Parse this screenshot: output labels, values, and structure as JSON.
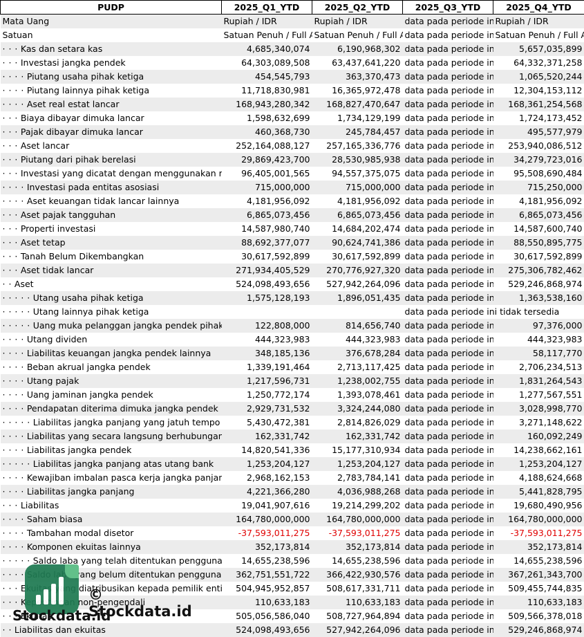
{
  "header": {
    "title": "PUDP",
    "periods": [
      "2025_Q1_YTD",
      "2025_Q2_YTD",
      "2025_Q3_YTD",
      "2025_Q4_YTD"
    ]
  },
  "rows": [
    {
      "label": "Mata Uang",
      "dots": "",
      "values": [
        "Rupiah / IDR",
        "Rupiah / IDR",
        "data pada periode ini",
        "Rupiah / IDR"
      ],
      "kind": "text"
    },
    {
      "label": "Satuan",
      "dots": "",
      "values": [
        "Satuan Penuh / Full Amount",
        "Satuan Penuh / Full Amount",
        "data pada periode ini",
        "Satuan Penuh / Full Amount"
      ],
      "kind": "text"
    },
    {
      "label": "Kas dan setara kas",
      "dots": "· · ·",
      "values": [
        "4,685,340,074",
        "6,190,968,302",
        "data pada periode in",
        "5,657,035,899"
      ]
    },
    {
      "label": "Investasi jangka pendek",
      "dots": "· · ·",
      "values": [
        "64,303,089,508",
        "63,437,641,220",
        "data pada periode in",
        "64,332,371,258"
      ]
    },
    {
      "label": "Piutang usaha pihak ketiga",
      "dots": "· · · ·",
      "values": [
        "454,545,793",
        "363,370,473",
        "data pada periode in",
        "1,065,520,244"
      ]
    },
    {
      "label": "Piutang lainnya pihak ketiga",
      "dots": "· · · ·",
      "values": [
        "11,718,830,981",
        "16,365,972,478",
        "data pada periode in",
        "12,304,153,112"
      ]
    },
    {
      "label": "Aset real estat lancar",
      "dots": "· · · ·",
      "values": [
        "168,943,280,342",
        "168,827,470,647",
        "data pada periode in",
        "168,361,254,568"
      ]
    },
    {
      "label": "Biaya dibayar dimuka lancar",
      "dots": "· · ·",
      "values": [
        "1,598,632,699",
        "1,734,129,199",
        "data pada periode in",
        "1,724,173,452"
      ]
    },
    {
      "label": "Pajak dibayar dimuka lancar",
      "dots": "· · ·",
      "values": [
        "460,368,730",
        "245,784,457",
        "data pada periode in",
        "495,577,979"
      ]
    },
    {
      "label": "Aset lancar",
      "dots": "· · ·",
      "values": [
        "252,164,088,127",
        "257,165,336,776",
        "data pada periode in",
        "253,940,086,512"
      ]
    },
    {
      "label": "Piutang dari pihak berelasi",
      "dots": "· · ·",
      "values": [
        "29,869,423,700",
        "28,530,985,938",
        "data pada periode in",
        "34,279,723,016"
      ]
    },
    {
      "label": "Investasi yang dicatat dengan menggunakan metode ekuitas",
      "dots": "· · ·",
      "values": [
        "96,405,001,565",
        "94,557,375,075",
        "data pada periode in",
        "95,508,690,484"
      ]
    },
    {
      "label": "Investasi pada entitas asosiasi",
      "dots": "· · · ·",
      "values": [
        "715,000,000",
        "715,000,000",
        "data pada periode in",
        "715,250,000"
      ]
    },
    {
      "label": "Aset keuangan tidak lancar lainnya",
      "dots": "· · · ·",
      "values": [
        "4,181,956,092",
        "4,181,956,092",
        "data pada periode in",
        "4,181,956,092"
      ]
    },
    {
      "label": "Aset pajak tangguhan",
      "dots": "· · ·",
      "values": [
        "6,865,073,456",
        "6,865,073,456",
        "data pada periode in",
        "6,865,073,456"
      ]
    },
    {
      "label": "Properti investasi",
      "dots": "· · ·",
      "values": [
        "14,587,980,740",
        "14,684,202,474",
        "data pada periode in",
        "14,587,600,740"
      ]
    },
    {
      "label": "Aset tetap",
      "dots": "· · ·",
      "values": [
        "88,692,377,077",
        "90,624,741,386",
        "data pada periode in",
        "88,550,895,775"
      ]
    },
    {
      "label": "Tanah Belum Dikembangkan",
      "dots": "· · ·",
      "values": [
        "30,617,592,899",
        "30,617,592,899",
        "data pada periode in",
        "30,617,592,899"
      ]
    },
    {
      "label": "Aset tidak lancar",
      "dots": "· · ·",
      "values": [
        "271,934,405,529",
        "270,776,927,320",
        "data pada periode in",
        "275,306,782,462"
      ]
    },
    {
      "label": "Aset",
      "dots": "· ·",
      "values": [
        "524,098,493,656",
        "527,942,264,096",
        "data pada periode in",
        "529,246,868,974"
      ]
    },
    {
      "label": "Utang usaha pihak ketiga",
      "dots": "· · · · ·",
      "values": [
        "1,575,128,193",
        "1,896,051,435",
        "data pada periode in",
        "1,363,538,160"
      ]
    },
    {
      "label": "Utang lainnya pihak ketiga",
      "dots": "· · · · ·",
      "values": [
        "",
        "",
        "data pada periode ini tidak tersedia",
        ""
      ],
      "kind": "span"
    },
    {
      "label": "Uang muka pelanggan jangka pendek pihak ketiga",
      "dots": "· · · · ·",
      "values": [
        "122,808,000",
        "814,656,740",
        "data pada periode in",
        "97,376,000"
      ]
    },
    {
      "label": "Utang dividen",
      "dots": "· · · ·",
      "values": [
        "444,323,983",
        "444,323,983",
        "data pada periode in",
        "444,323,983"
      ]
    },
    {
      "label": "Liabilitas keuangan jangka pendek lainnya",
      "dots": "· · · ·",
      "values": [
        "348,185,136",
        "376,678,284",
        "data pada periode in",
        "58,117,770"
      ]
    },
    {
      "label": "Beban akrual jangka pendek",
      "dots": "· · · ·",
      "values": [
        "1,339,191,464",
        "2,713,117,425",
        "data pada periode in",
        "2,706,234,513"
      ]
    },
    {
      "label": "Utang pajak",
      "dots": "· · · ·",
      "values": [
        "1,217,596,731",
        "1,238,002,755",
        "data pada periode in",
        "1,831,264,543"
      ]
    },
    {
      "label": "Uang jaminan jangka pendek",
      "dots": "· · · ·",
      "values": [
        "1,250,772,174",
        "1,393,078,461",
        "data pada periode in",
        "1,277,567,551"
      ]
    },
    {
      "label": "Pendapatan diterima dimuka jangka pendek",
      "dots": "· · · ·",
      "values": [
        "2,929,731,532",
        "3,324,244,080",
        "data pada periode in",
        "3,028,998,770"
      ]
    },
    {
      "label": "Liabilitas jangka panjang yang jatuh tempo dalam satu tahun",
      "dots": "· · · · ·",
      "values": [
        "5,430,472,381",
        "2,814,826,029",
        "data pada periode in",
        "3,271,148,622"
      ]
    },
    {
      "label": "Liabilitas yang secara langsung berhubungan dengan aset",
      "dots": "· · · ·",
      "values": [
        "162,331,742",
        "162,331,742",
        "data pada periode in",
        "160,092,249"
      ]
    },
    {
      "label": "Liabilitas jangka pendek",
      "dots": "· · · ·",
      "values": [
        "14,820,541,336",
        "15,177,310,934",
        "data pada periode in",
        "14,238,662,161"
      ]
    },
    {
      "label": "Liabilitas jangka panjang atas utang bank",
      "dots": "· · · · ·",
      "values": [
        "1,253,204,127",
        "1,253,204,127",
        "data pada periode in",
        "1,253,204,127"
      ]
    },
    {
      "label": "Kewajiban imbalan pasca kerja jangka panjang",
      "dots": "· · · ·",
      "values": [
        "2,968,162,153",
        "2,783,784,141",
        "data pada periode in",
        "4,188,624,668"
      ]
    },
    {
      "label": "Liabilitas jangka panjang",
      "dots": "· · · ·",
      "values": [
        "4,221,366,280",
        "4,036,988,268",
        "data pada periode in",
        "5,441,828,795"
      ]
    },
    {
      "label": "Liabilitas",
      "dots": "· · ·",
      "values": [
        "19,041,907,616",
        "19,214,299,202",
        "data pada periode in",
        "19,680,490,956"
      ]
    },
    {
      "label": "Saham biasa",
      "dots": "· · · ·",
      "values": [
        "164,780,000,000",
        "164,780,000,000",
        "data pada periode in",
        "164,780,000,000"
      ]
    },
    {
      "label": "Tambahan modal disetor",
      "dots": "· · · ·",
      "values": [
        "-37,593,011,275",
        "-37,593,011,275",
        "data pada periode in",
        "-37,593,011,275"
      ],
      "negative": true
    },
    {
      "label": "Komponen ekuitas lainnya",
      "dots": "· · · ·",
      "values": [
        "352,173,814",
        "352,173,814",
        "data pada periode in",
        "352,173,814"
      ]
    },
    {
      "label": "Saldo laba yang telah ditentukan penggunaannya",
      "dots": "· · · · ·",
      "values": [
        "14,655,238,596",
        "14,655,238,596",
        "data pada periode in",
        "14,655,238,596"
      ]
    },
    {
      "label": "Saldo laba yang belum ditentukan penggunaannya",
      "dots": "· · · ·",
      "values": [
        "362,751,551,722",
        "366,422,930,576",
        "data pada periode in",
        "367,261,343,700"
      ]
    },
    {
      "label": "Ekuitas yang diatribusikan kepada pemilik entitas induk",
      "dots": "· · ·",
      "values": [
        "504,945,952,857",
        "508,617,331,711",
        "data pada periode in",
        "509,455,744,835"
      ]
    },
    {
      "label": "Kepentingan non-pengendali",
      "dots": "· · ·",
      "values": [
        "110,633,183",
        "110,633,183",
        "data pada periode in",
        "110,633,183"
      ]
    },
    {
      "label": "Ekuitas",
      "dots": "· · ·",
      "values": [
        "505,056,586,040",
        "508,727,964,894",
        "data pada periode in",
        "509,566,378,018"
      ]
    },
    {
      "label": "Liabilitas dan ekuitas",
      "dots": "· ·",
      "values": [
        "524,098,493,656",
        "527,942,264,096",
        "data pada periode in",
        "529,246,868,974"
      ]
    }
  ],
  "watermark": {
    "copyright": "© Stockdata.id",
    "brand": "Stockdata.id",
    "logo_icon": "bar-chart-logo-icon",
    "colors": {
      "logo": "#1f7a52",
      "accent": "#62c08a",
      "negative": "#e00000"
    }
  }
}
